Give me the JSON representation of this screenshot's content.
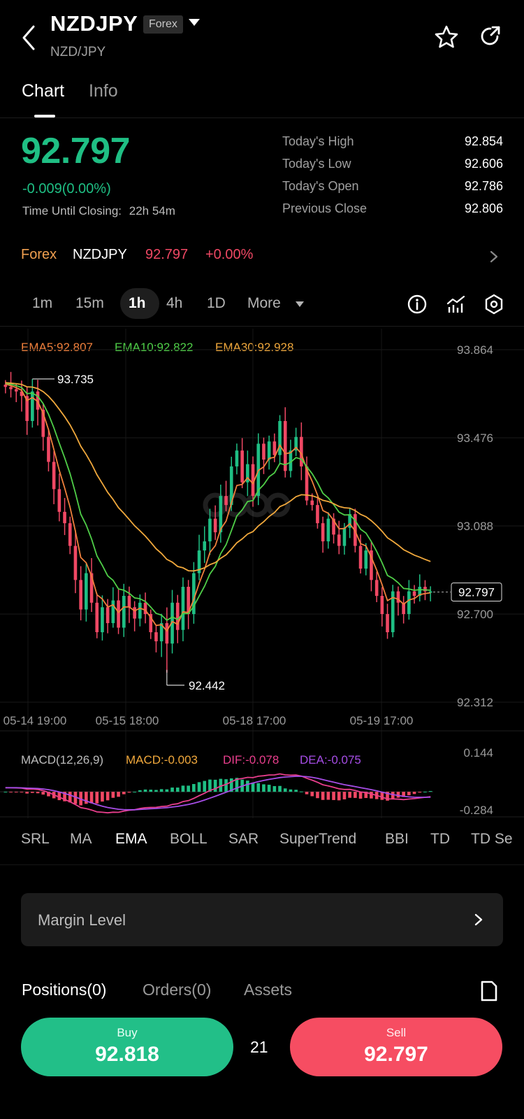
{
  "header": {
    "symbol": "NZDJPY",
    "tag": "Forex",
    "pair": "NZD/JPY"
  },
  "tabs": [
    {
      "label": "Chart",
      "active": true
    },
    {
      "label": "Info",
      "active": false
    }
  ],
  "quote": {
    "price": "92.797",
    "change": "-0.009(0.00%)",
    "closing_label": "Time Until Closing:",
    "closing_value": "22h 54m",
    "stats": [
      {
        "label": "Today's High",
        "value": "92.854"
      },
      {
        "label": "Today's Low",
        "value": "92.606"
      },
      {
        "label": "Today's Open",
        "value": "92.786"
      },
      {
        "label": "Previous Close",
        "value": "92.806"
      }
    ]
  },
  "ticker": {
    "market": "Forex",
    "symbol": "NZDJPY",
    "price": "92.797",
    "change": "+0.00%"
  },
  "intervals": [
    "1m",
    "15m",
    "1h",
    "4h",
    "1D",
    "More"
  ],
  "active_interval": "1h",
  "chart_data": {
    "type": "candlestick",
    "ema_legend": {
      "ema5": "EMA5:92.807",
      "ema10": "EMA10:92.822",
      "ema30": "EMA30:92.928"
    },
    "y_ticks": [
      "93.864",
      "93.476",
      "93.088",
      "92.700",
      "92.312"
    ],
    "ylim": [
      92.312,
      93.864
    ],
    "x_ticks": [
      "05-14 19:00",
      "05-15 18:00",
      "05-18 17:00",
      "05-19 17:00"
    ],
    "high_label": "93.735",
    "low_label": "92.442",
    "current_label": "92.797",
    "close_series": [
      93.7,
      93.69,
      93.68,
      93.66,
      93.55,
      93.68,
      93.6,
      93.48,
      93.37,
      93.25,
      93.15,
      93.1,
      93.0,
      92.85,
      92.72,
      92.88,
      92.75,
      92.62,
      92.73,
      92.66,
      92.76,
      92.64,
      92.78,
      92.73,
      92.68,
      92.75,
      92.7,
      92.62,
      92.58,
      92.66,
      92.57,
      92.75,
      92.63,
      92.82,
      92.7,
      92.88,
      92.98,
      93.02,
      93.12,
      93.06,
      93.22,
      93.18,
      93.35,
      93.42,
      93.28,
      93.36,
      93.22,
      93.45,
      93.38,
      93.46,
      93.4,
      93.55,
      93.33,
      93.42,
      93.48,
      93.35,
      93.2,
      93.18,
      93.1,
      93.02,
      93.12,
      93.05,
      93.0,
      93.08,
      93.14,
      93.0,
      92.9,
      92.98,
      92.85,
      92.78,
      92.7,
      92.62,
      92.8,
      92.75,
      92.7,
      92.8,
      92.78,
      92.82,
      92.8,
      92.8
    ],
    "macd": {
      "label": "MACD(12,26,9)",
      "macd": "MACD:-0.003",
      "dif": "DIF:-0.078",
      "dea": "DEA:-0.075",
      "y_ticks": [
        "0.144",
        "-0.284"
      ],
      "ylim": [
        -0.284,
        0.144
      ]
    },
    "colors": {
      "up": "#1fbf84",
      "down": "#f04864",
      "ema5": "#f0803c",
      "ema10": "#4fce48",
      "ema30": "#f0a83c",
      "dif": "#e83e8c",
      "dea": "#a64de6"
    }
  },
  "indicators": [
    "SRL",
    "MA",
    "EMA",
    "BOLL",
    "SAR",
    "SuperTrend",
    "BBI",
    "TD",
    "TD Se"
  ],
  "active_indicator": "EMA",
  "margin_label": "Margin Level",
  "position_tabs": [
    "Positions(0)",
    "Orders(0)",
    "Assets"
  ],
  "trade": {
    "buy_label": "Buy",
    "buy_price": "92.818",
    "spread": "21",
    "sell_label": "Sell",
    "sell_price": "92.797"
  }
}
